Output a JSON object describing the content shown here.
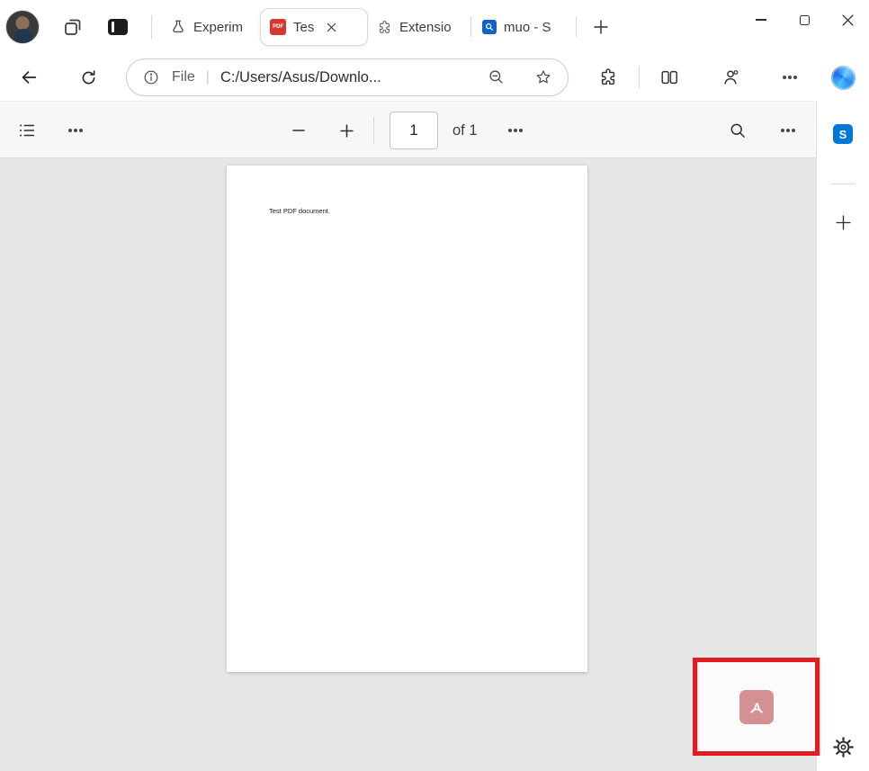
{
  "tab_bar": {
    "tabs": [
      {
        "label": "Experim"
      },
      {
        "label": "Tes",
        "favicon_text": "PDF",
        "active": true
      },
      {
        "label": "Extensio"
      },
      {
        "label": "muo - S"
      }
    ]
  },
  "nav": {
    "file_label": "File",
    "url": "C:/Users/Asus/Downlo...",
    "separator": "|"
  },
  "pdf_toolbar": {
    "page_value": "1",
    "page_total": "of 1"
  },
  "document": {
    "text": "Test PDF document."
  },
  "sidebar": {
    "s_badge": "S"
  },
  "colors": {
    "favicon_pdf_red": "#d6362b",
    "favicon_search_blue": "#1262c6",
    "sidebar_s_blue": "#0078d4",
    "highlight_red": "#e11d23",
    "adobe_button_pink": "#d59093",
    "copilot_blue": "#1d6ef0"
  }
}
